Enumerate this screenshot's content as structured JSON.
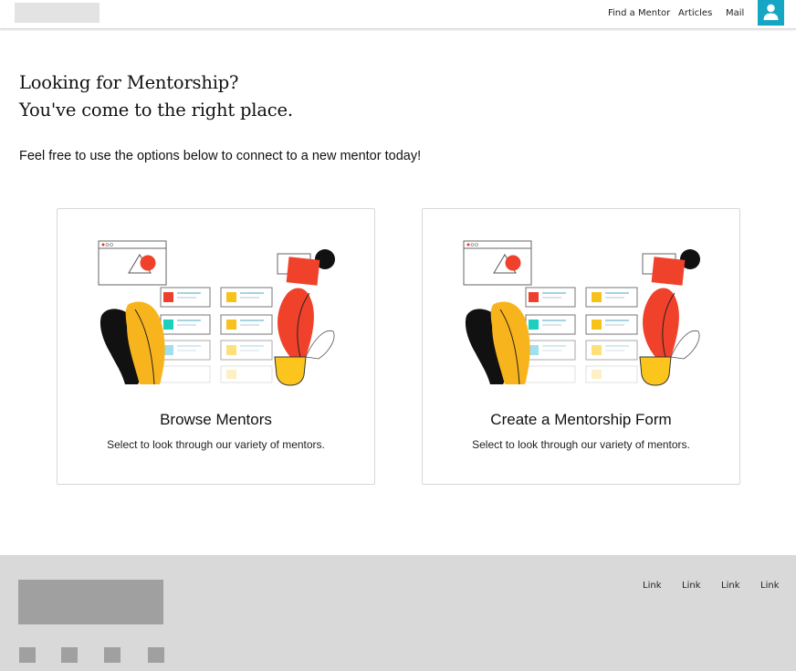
{
  "header": {
    "nav": {
      "find_mentor": "Find a Mentor",
      "articles": "Articles",
      "mail": "Mail"
    },
    "avatar_icon": "user-icon",
    "accent_color": "#14a6c3"
  },
  "hero": {
    "title_line1": "Looking for Mentorship?",
    "title_line2": "You've come to the right place.",
    "subtitle": "Feel free to use the options below to connect to a new mentor today!"
  },
  "cards": [
    {
      "title": "Browse Mentors",
      "description": "Select to look through our variety of mentors.",
      "illustration": "mentor-illustration"
    },
    {
      "title": "Create a Mentorship Form",
      "description": "Select to look through our variety of mentors.",
      "illustration": "mentor-illustration"
    }
  ],
  "footer": {
    "links": [
      "Link",
      "Link",
      "Link",
      "Link"
    ],
    "social_icons": [
      "social-icon-1",
      "social-icon-2",
      "social-icon-3",
      "social-icon-4"
    ]
  }
}
